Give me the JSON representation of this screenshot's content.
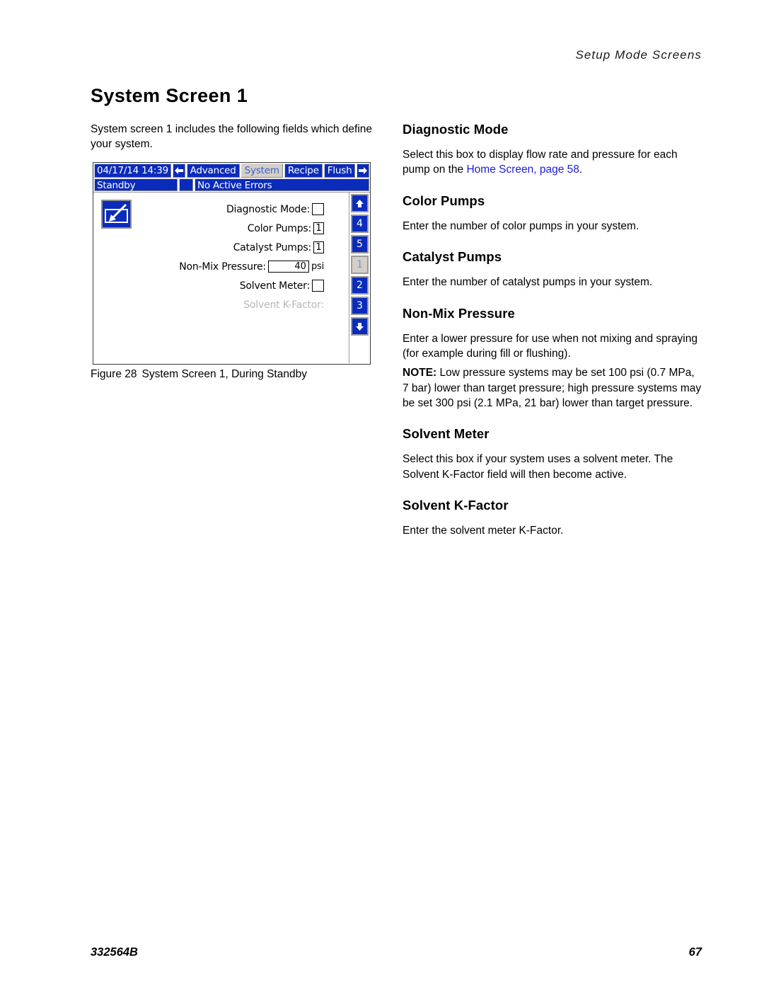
{
  "header": {
    "running_head": "Setup Mode Screens"
  },
  "footer": {
    "doc_number": "332564B",
    "page_number": "67"
  },
  "page": {
    "title": "System Screen 1",
    "intro": "System screen 1 includes the following fields which define your system."
  },
  "figure": {
    "number": "Figure 28",
    "caption": "System Screen 1, During Standby"
  },
  "device": {
    "datetime": "04/17/14 14:39",
    "back_arrow_icon": "arrow-left-icon",
    "forward_arrow_icon": "arrow-right-icon",
    "tabs": [
      {
        "label": "Advanced",
        "selected": false
      },
      {
        "label": "System",
        "selected": true
      },
      {
        "label": "Recipe",
        "selected": false
      },
      {
        "label": "Flush",
        "selected": false
      }
    ],
    "status": {
      "mode": "Standby",
      "errors": "No Active Errors"
    },
    "edit_icon": "edit-screen-icon",
    "fields": [
      {
        "label": "Diagnostic Mode:",
        "type": "checkbox",
        "value": "",
        "unit": "",
        "disabled": false
      },
      {
        "label": "Color Pumps:",
        "type": "number",
        "value": "1",
        "unit": "",
        "disabled": false
      },
      {
        "label": "Catalyst Pumps:",
        "type": "number",
        "value": "1",
        "unit": "",
        "disabled": false
      },
      {
        "label": "Non-Mix Pressure:",
        "type": "number-wide",
        "value": "40",
        "unit": "psi",
        "disabled": false
      },
      {
        "label": "Solvent Meter:",
        "type": "checkbox",
        "value": "",
        "unit": "",
        "disabled": false
      },
      {
        "label": "Solvent K-Factor:",
        "type": "none",
        "value": "",
        "unit": "",
        "disabled": true
      }
    ],
    "sidebar": [
      {
        "label": "",
        "icon": "arrow-up-icon",
        "selected": false
      },
      {
        "label": "4",
        "icon": "",
        "selected": false
      },
      {
        "label": "5",
        "icon": "",
        "selected": false
      },
      {
        "label": "1",
        "icon": "",
        "selected": true
      },
      {
        "label": "2",
        "icon": "",
        "selected": false
      },
      {
        "label": "3",
        "icon": "",
        "selected": false
      },
      {
        "label": "",
        "icon": "arrow-down-icon",
        "selected": false
      }
    ]
  },
  "sections": {
    "diagnostic_mode": {
      "heading": "Diagnostic Mode",
      "body_before_link": "Select this box to display flow rate and pressure for each pump on the ",
      "link_text": "Home Screen, page 58",
      "body_after_link": "."
    },
    "color_pumps": {
      "heading": "Color Pumps",
      "body": "Enter the number of color pumps in your system."
    },
    "catalyst_pumps": {
      "heading": "Catalyst Pumps",
      "body": "Enter the number of catalyst pumps in your system."
    },
    "non_mix_pressure": {
      "heading": "Non-Mix Pressure",
      "body": "Enter a lower pressure for use when not mixing and spraying (for example during fill or flushing).",
      "note_label": "NOTE:",
      "note_body": " Low pressure systems may be set 100 psi (0.7 MPa, 7 bar) lower than target pressure; high pressure systems may be set 300 psi (2.1 MPa, 21 bar) lower than target pressure."
    },
    "solvent_meter": {
      "heading": "Solvent Meter",
      "body": "Select this box if your system uses a solvent meter. The Solvent K-Factor field will then become active."
    },
    "solvent_k_factor": {
      "heading": "Solvent K-Factor",
      "body": "Enter the solvent meter K-Factor."
    }
  },
  "colors": {
    "device_blue": "#0b2bbb",
    "selected_tab_bg": "#d4d0c8",
    "link_blue": "#1c1cdd",
    "disabled_gray": "#b6b6b6"
  }
}
